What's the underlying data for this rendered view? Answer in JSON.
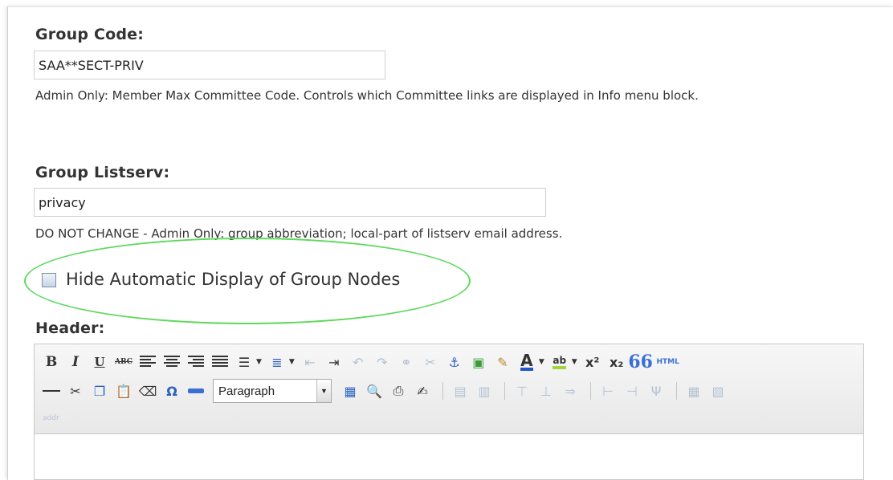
{
  "group_code": {
    "label": "Group Code:",
    "value": "SAA**SECT-PRIV",
    "description": "Admin Only: Member Max Committee Code. Controls which Committee links are displayed in Info menu block."
  },
  "group_listserv": {
    "label": "Group Listserv:",
    "value": "privacy",
    "description": "DO NOT CHANGE - Admin Only: group abbreviation; local-part of listserv email address."
  },
  "hide_nodes": {
    "label": "Hide Automatic Display of Group Nodes",
    "checked": false
  },
  "header": {
    "label": "Header:",
    "toolbar": {
      "bold": "B",
      "italic": "I",
      "underline": "U",
      "strikethrough": "ABC",
      "format_select_value": "Paragraph",
      "special_char": "Ω",
      "font_color": "A",
      "highlight": "ab",
      "superscript": "x²",
      "subscript": "x₂",
      "blockquote": "66",
      "html": "HTML"
    },
    "path": "addr"
  },
  "colors": {
    "highlight_ellipse": "#5dd95d",
    "font_color_bar": "#2255cc",
    "highlight_bar": "#9fd53b"
  }
}
